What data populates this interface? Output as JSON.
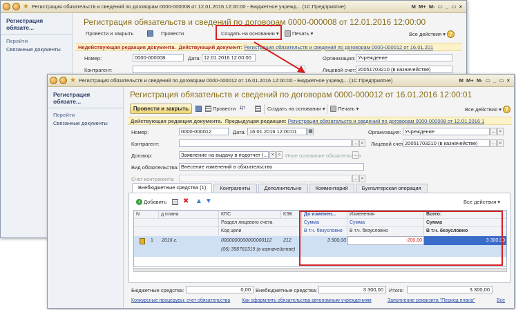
{
  "back_window": {
    "title": "Регистрация обязательств и сведений по договорам 0000-000008 от 12.01.2016 12:00:00 - Бюджетное учрежд... (1С:Предприятие)",
    "sidebar_title": "Регистрация обязате...",
    "sidebar_group": "Перейти",
    "sidebar_link": "Связанные документы",
    "doc_title": "Регистрация обязательств и сведений по договорам 0000-000008 от 12.01.2016 12:00:00",
    "toolbar": {
      "post_close": "Провести и закрыть",
      "post": "Провести",
      "create_based": "Создать на основании",
      "print": "Печать",
      "all_actions": "Все действия"
    },
    "info": {
      "status": "Недействующая редакция документа.",
      "current_label": "Действующий документ:",
      "current_link": "Регистрация обязательств и сведений по договорам 0000-000012 от 16.01.201"
    },
    "number_label": "Номер:",
    "number_value": "0000-000008",
    "date_label": "Дата:",
    "date_value": "12.01.2016 12:00:00",
    "org_label": "Организация:",
    "org_value": "Учреждение",
    "contractor_label": "Контрагент:",
    "account_label": "Лицевой счет:",
    "account_value": "20051703210 (в казначействе)"
  },
  "front_window": {
    "title": "Регистрация обязательств и сведений по договорам 0000-000012 от 16.01.2016 12:00:00 - Бюджетное учрежд... (1С:Предприятие)",
    "title_right": [
      "M",
      "M+",
      "M-",
      "□",
      "_",
      "□",
      "×"
    ],
    "sidebar_title": "Регистрация обязате...",
    "sidebar_group": "Перейти",
    "sidebar_link": "Связанные документы",
    "doc_title": "Регистрация обязательств и сведений по договорам 0000-000012 от 16.01.2016 12:00:01",
    "toolbar": {
      "post_close": "Провести и закрыть",
      "post": "Провести",
      "create_based": "Создать на основании",
      "print": "Печать",
      "all_actions": "Все действия"
    },
    "info": {
      "status": "Действующая редакция документа.",
      "prev_label": "Предыдущая редакция:",
      "prev_link": "Регистрация обязательств и сведений по договорам 0000-000008 от 12.01.2016 1"
    },
    "number_label": "Номер:",
    "number_value": "0000-000012",
    "date_label": "Дата:",
    "date_value": "16.01.2016 12:00:01",
    "org_label": "Организация:",
    "org_value": "Учреждение",
    "contractor_label": "Контрагент:",
    "account_label": "Лицевой счет:",
    "account_value": "20051703210 (в казначействе)",
    "contract_label": "Договор:",
    "contract_value": "Заявление на выдачу в подотчет (...",
    "contract_hint": "Иное основание обязательства",
    "obligation_label": "Вид обязательства:",
    "obligation_value": "Внесение изменений в обязательство",
    "contractor_account_label": "Счет контрагента:",
    "tabs": [
      "Внебюджетные средства (1)",
      "Контрагенты",
      "Дополнительно",
      "Комментарий",
      "Бухгалтерская операция"
    ],
    "table_toolbar": {
      "add": "Добавить",
      "all_actions": "Все действия"
    },
    "grid": {
      "headers_row1": [
        "N",
        "д плана",
        "КПС",
        "КЭК",
        "До изменен...",
        "Изменения",
        "Всего:"
      ],
      "headers_row2": [
        "Раздел лицевого счета",
        "Сумма",
        "Сумма",
        "Сумма"
      ],
      "headers_row3": [
        "Код цели",
        "В т.ч. безусловно",
        "В т.ч. безусловно",
        "В т.ч. безусловно"
      ],
      "row": {
        "n": "1",
        "plan": "2016 г.",
        "kps": "0000000000000000112",
        "kek": "212",
        "before": "3 500,00",
        "change": "-200,00",
        "total": "3 300,00",
        "section": "(06) 358761319 (в казначействе)"
      }
    },
    "totals": {
      "budget_label": "Бюджетные средства:",
      "budget_value": "0,00",
      "extrabudget_label": "Внебюджетные средства:",
      "extrabudget_value": "3 300,00",
      "total_label": "Итого:",
      "total_value": "3 300,00"
    },
    "links": [
      "Конкурсные процедуры: счет обязательства",
      "Как оформлять обязательства автономным учреждениям",
      "Заполнение реквизита \"Период плана\"",
      "Все"
    ]
  }
}
